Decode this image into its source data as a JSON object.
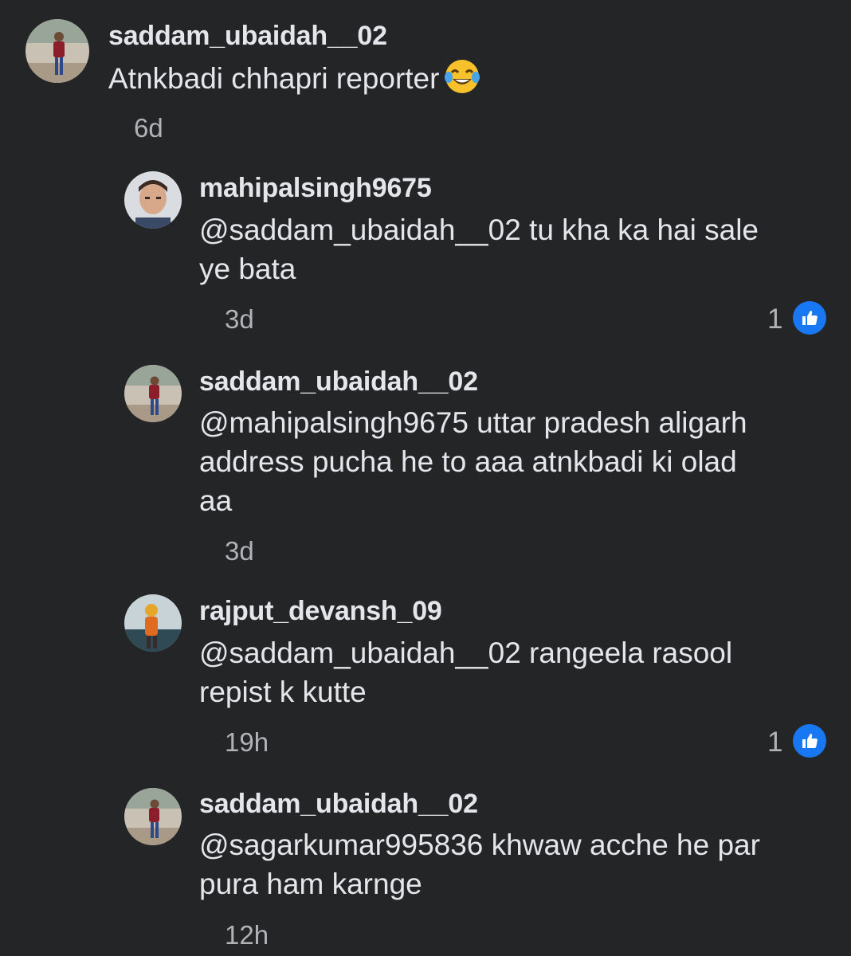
{
  "comments": [
    {
      "username": "saddam_ubaidah__02",
      "lines": [
        "Atnkbadi chhapri reporter"
      ],
      "emoji": "face-with-tears-of-joy",
      "time": "6d",
      "likes": ""
    },
    {
      "username": "mahipalsingh9675",
      "lines": [
        "@saddam_ubaidah__02 tu kha ka hai sale",
        "ye bata"
      ],
      "time": "3d",
      "likes": "1"
    },
    {
      "username": "saddam_ubaidah__02",
      "lines": [
        "@mahipalsingh9675 uttar pradesh aligarh",
        "address pucha he to aaa atnkbadi ki olad",
        "aa"
      ],
      "time": "3d",
      "likes": ""
    },
    {
      "username": "rajput_devansh_09",
      "lines": [
        "@saddam_ubaidah__02 rangeela rasool",
        "repist k kutte"
      ],
      "time": "19h",
      "likes": "1"
    },
    {
      "username": "saddam_ubaidah__02",
      "lines": [
        "@sagarkumar995836 khwaw acche he par",
        "pura ham karnge"
      ],
      "time": "12h",
      "likes": ""
    }
  ],
  "colors": {
    "background": "#242526",
    "text": "#e4e6eb",
    "secondary": "#b0b3b8",
    "like_blue": "#1877f2"
  }
}
